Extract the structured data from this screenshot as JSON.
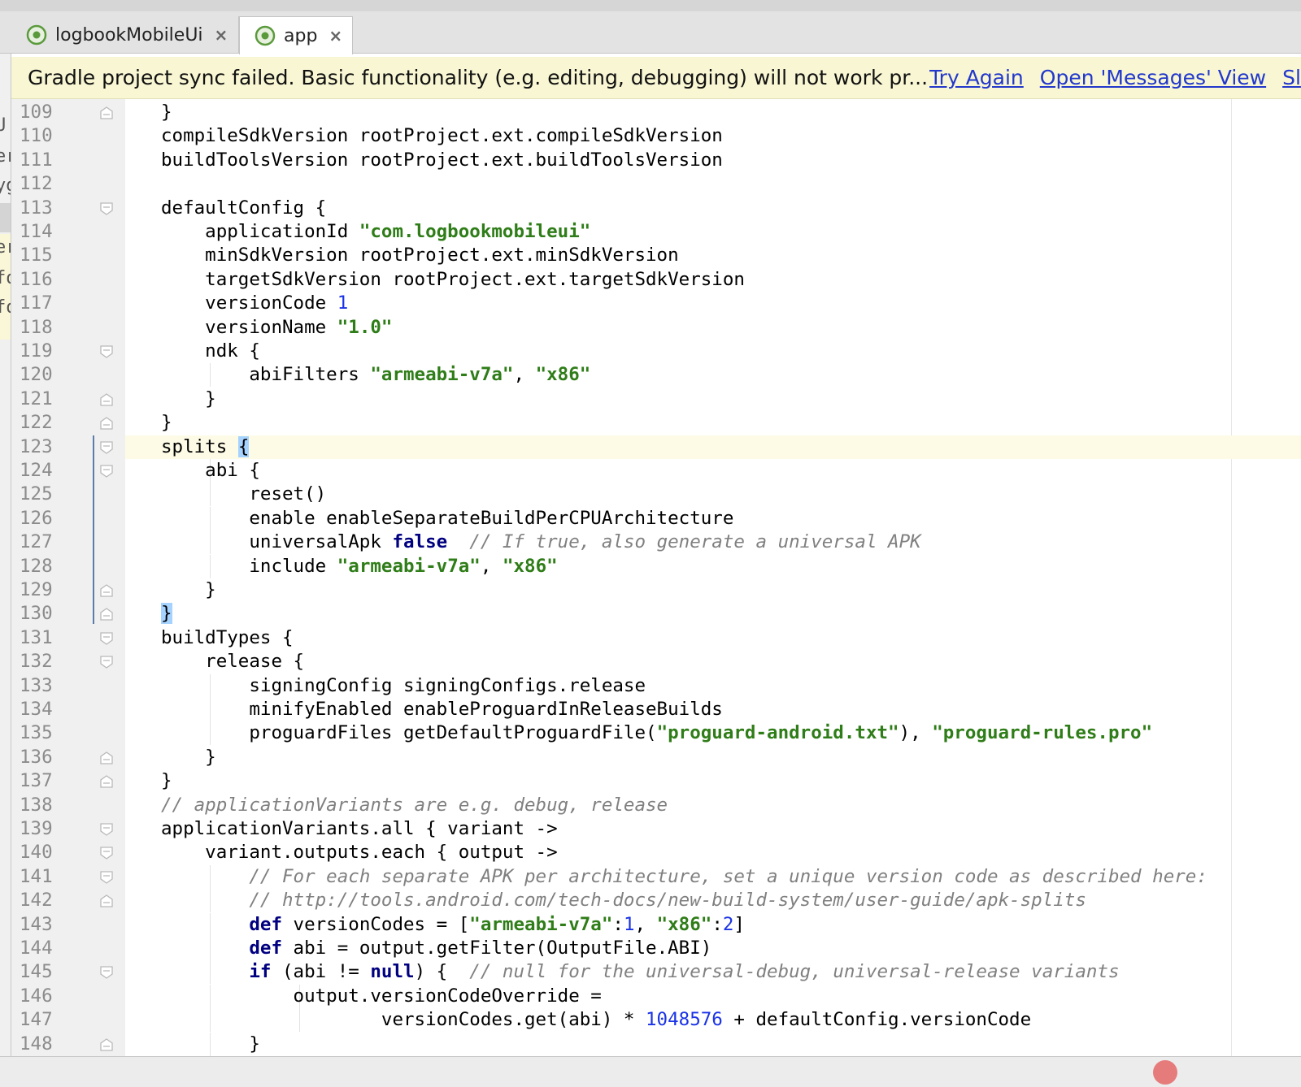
{
  "tabs": [
    {
      "label": "logbookMobileUi",
      "close": "×",
      "icon": "android-studio-icon"
    },
    {
      "label": "app",
      "close": "×",
      "icon": "android-studio-icon",
      "active": true
    }
  ],
  "banner": {
    "message": "Gradle project sync failed. Basic functionality (e.g. editing, debugging) will not work pr...",
    "links": [
      "Try Again",
      "Open 'Messages' View",
      "Sl"
    ]
  },
  "left_fragments": [
    "U",
    "er",
    "yg",
    "er",
    "fo",
    "fo"
  ],
  "colors": {
    "string": "#2f7d18",
    "keyword": "#000080",
    "number": "#1a33e6",
    "comment": "#808080",
    "banner_bg": "#f8f6d3",
    "link": "#2238cc"
  },
  "current_line": 123,
  "lines": [
    {
      "n": "109",
      "fold": "end",
      "tokens": [
        [
          "t",
          "    }"
        ]
      ]
    },
    {
      "n": "110",
      "tokens": [
        [
          "t",
          "    compileSdkVersion rootProject.ext.compileSdkVersion"
        ]
      ]
    },
    {
      "n": "111",
      "tokens": [
        [
          "t",
          "    buildToolsVersion rootProject.ext.buildToolsVersion"
        ]
      ]
    },
    {
      "n": "112",
      "tokens": []
    },
    {
      "n": "113",
      "fold": "start",
      "tokens": [
        [
          "t",
          "    defaultConfig {"
        ]
      ]
    },
    {
      "n": "114",
      "tokens": [
        [
          "t",
          "        applicationId "
        ],
        [
          "s",
          "\"com.logbookmobileui\""
        ]
      ]
    },
    {
      "n": "115",
      "tokens": [
        [
          "t",
          "        minSdkVersion rootProject.ext.minSdkVersion"
        ]
      ]
    },
    {
      "n": "116",
      "tokens": [
        [
          "t",
          "        targetSdkVersion rootProject.ext.targetSdkVersion"
        ]
      ]
    },
    {
      "n": "117",
      "tokens": [
        [
          "t",
          "        versionCode "
        ],
        [
          "n",
          "1"
        ]
      ]
    },
    {
      "n": "118",
      "tokens": [
        [
          "t",
          "        versionName "
        ],
        [
          "s",
          "\"1.0\""
        ]
      ]
    },
    {
      "n": "119",
      "fold": "start",
      "tokens": [
        [
          "t",
          "        ndk {"
        ]
      ]
    },
    {
      "n": "120",
      "tokens": [
        [
          "t",
          "            abiFilters "
        ],
        [
          "s",
          "\"armeabi-v7a\""
        ],
        [
          "t",
          ", "
        ],
        [
          "s",
          "\"x86\""
        ]
      ]
    },
    {
      "n": "121",
      "fold": "end",
      "tokens": [
        [
          "t",
          "        }"
        ]
      ]
    },
    {
      "n": "122",
      "fold": "end",
      "tokens": [
        [
          "t",
          "    }"
        ]
      ]
    },
    {
      "n": "123",
      "fold": "start",
      "tokens": [
        [
          "t",
          "    splits "
        ],
        [
          "b",
          "{"
        ]
      ]
    },
    {
      "n": "124",
      "fold": "start",
      "tokens": [
        [
          "t",
          "        abi {"
        ]
      ]
    },
    {
      "n": "125",
      "tokens": [
        [
          "t",
          "            reset()"
        ]
      ]
    },
    {
      "n": "126",
      "tokens": [
        [
          "t",
          "            enable enableSeparateBuildPerCPUArchitecture"
        ]
      ]
    },
    {
      "n": "127",
      "tokens": [
        [
          "t",
          "            universalApk "
        ],
        [
          "k",
          "false"
        ],
        [
          "t",
          "  "
        ],
        [
          "c",
          "// If true, also generate a universal APK"
        ]
      ]
    },
    {
      "n": "128",
      "tokens": [
        [
          "t",
          "            include "
        ],
        [
          "s",
          "\"armeabi-v7a\""
        ],
        [
          "t",
          ", "
        ],
        [
          "s",
          "\"x86\""
        ]
      ]
    },
    {
      "n": "129",
      "fold": "end",
      "tokens": [
        [
          "t",
          "        }"
        ]
      ]
    },
    {
      "n": "130",
      "fold": "end",
      "tokens": [
        [
          "t",
          "    "
        ],
        [
          "b",
          "}"
        ]
      ]
    },
    {
      "n": "131",
      "fold": "start",
      "tokens": [
        [
          "t",
          "    buildTypes {"
        ]
      ]
    },
    {
      "n": "132",
      "fold": "start",
      "tokens": [
        [
          "t",
          "        release {"
        ]
      ]
    },
    {
      "n": "133",
      "tokens": [
        [
          "t",
          "            signingConfig signingConfigs.release"
        ]
      ]
    },
    {
      "n": "134",
      "tokens": [
        [
          "t",
          "            minifyEnabled enableProguardInReleaseBuilds"
        ]
      ]
    },
    {
      "n": "135",
      "tokens": [
        [
          "t",
          "            proguardFiles getDefaultProguardFile("
        ],
        [
          "s",
          "\"proguard-android.txt\""
        ],
        [
          "t",
          "), "
        ],
        [
          "s",
          "\"proguard-rules.pro\""
        ]
      ]
    },
    {
      "n": "136",
      "fold": "end",
      "tokens": [
        [
          "t",
          "        }"
        ]
      ]
    },
    {
      "n": "137",
      "fold": "end",
      "tokens": [
        [
          "t",
          "    }"
        ]
      ]
    },
    {
      "n": "138",
      "tokens": [
        [
          "t",
          "    "
        ],
        [
          "c",
          "// applicationVariants are e.g. debug, release"
        ]
      ]
    },
    {
      "n": "139",
      "fold": "start",
      "tokens": [
        [
          "t",
          "    applicationVariants.all { variant ->"
        ]
      ]
    },
    {
      "n": "140",
      "fold": "start",
      "tokens": [
        [
          "t",
          "        variant.outputs.each { output ->"
        ]
      ]
    },
    {
      "n": "141",
      "fold": "start",
      "tokens": [
        [
          "t",
          "            "
        ],
        [
          "c",
          "// For each separate APK per architecture, set a unique version code as described here:"
        ]
      ]
    },
    {
      "n": "142",
      "fold": "end",
      "tokens": [
        [
          "t",
          "            "
        ],
        [
          "c",
          "// http://tools.android.com/tech-docs/new-build-system/user-guide/apk-splits"
        ]
      ]
    },
    {
      "n": "143",
      "tokens": [
        [
          "t",
          "            "
        ],
        [
          "k",
          "def"
        ],
        [
          "t",
          " versionCodes = ["
        ],
        [
          "s",
          "\"armeabi-v7a\""
        ],
        [
          "t",
          ":"
        ],
        [
          "n",
          "1"
        ],
        [
          "t",
          ", "
        ],
        [
          "s",
          "\"x86\""
        ],
        [
          "t",
          ":"
        ],
        [
          "n",
          "2"
        ],
        [
          "t",
          "]"
        ]
      ]
    },
    {
      "n": "144",
      "tokens": [
        [
          "t",
          "            "
        ],
        [
          "k",
          "def"
        ],
        [
          "t",
          " abi = output.getFilter(OutputFile.ABI)"
        ]
      ]
    },
    {
      "n": "145",
      "fold": "start",
      "tokens": [
        [
          "t",
          "            "
        ],
        [
          "k",
          "if"
        ],
        [
          "t",
          " (abi != "
        ],
        [
          "k",
          "null"
        ],
        [
          "t",
          ") {  "
        ],
        [
          "c",
          "// null for the universal-debug, universal-release variants"
        ]
      ]
    },
    {
      "n": "146",
      "tokens": [
        [
          "t",
          "                output.versionCodeOverride ="
        ]
      ]
    },
    {
      "n": "147",
      "tokens": [
        [
          "t",
          "                        versionCodes.get(abi) * "
        ],
        [
          "n",
          "1048576"
        ],
        [
          "t",
          " + defaultConfig.versionCode"
        ]
      ]
    },
    {
      "n": "148",
      "fold": "end",
      "tokens": [
        [
          "t",
          "            }"
        ]
      ]
    }
  ]
}
